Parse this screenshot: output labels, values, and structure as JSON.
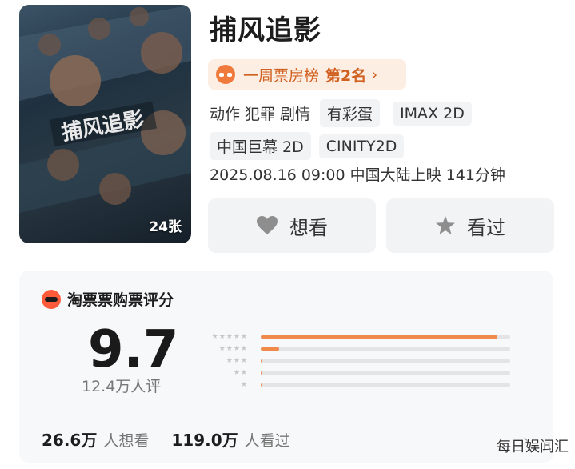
{
  "movie": {
    "title": "捕风追影",
    "poster_count": "24张",
    "poster_text": "捕风追影"
  },
  "ranking": {
    "label": "一周票房榜",
    "position": "第2名",
    "chevron": "›"
  },
  "genres": [
    "动作",
    "犯罪",
    "剧情"
  ],
  "format_tags_row1": [
    "有彩蛋",
    "IMAX 2D"
  ],
  "format_tags_row2": [
    "中国巨幕 2D",
    "CINITY2D"
  ],
  "release_info": "2025.08.16 09:00 中国大陆上映 141分钟",
  "actions": {
    "want_label": "想看",
    "seen_label": "看过"
  },
  "rating": {
    "source_label": "淘票票购票评分",
    "score": "9.7",
    "count_label": "12.4万人评",
    "distribution": [
      {
        "stars": "★★★★★",
        "fraction": 0.95
      },
      {
        "stars": "★★★★",
        "fraction": 0.075
      },
      {
        "stars": "★★★",
        "fraction": 0.008
      },
      {
        "stars": "★★",
        "fraction": 0.004
      },
      {
        "stars": "★",
        "fraction": 0.003
      }
    ],
    "want_count": "26.6万",
    "want_suffix": "人想看",
    "seen_count": "119.0万",
    "seen_suffix": "人看过",
    "chevron": "›"
  },
  "colors": {
    "accent": "#f08a4b",
    "rank_text": "#d0601f",
    "rank_bg": "#fdeee3",
    "chip_bg": "#f2f3f5"
  },
  "watermark": "每日娱闻汇"
}
